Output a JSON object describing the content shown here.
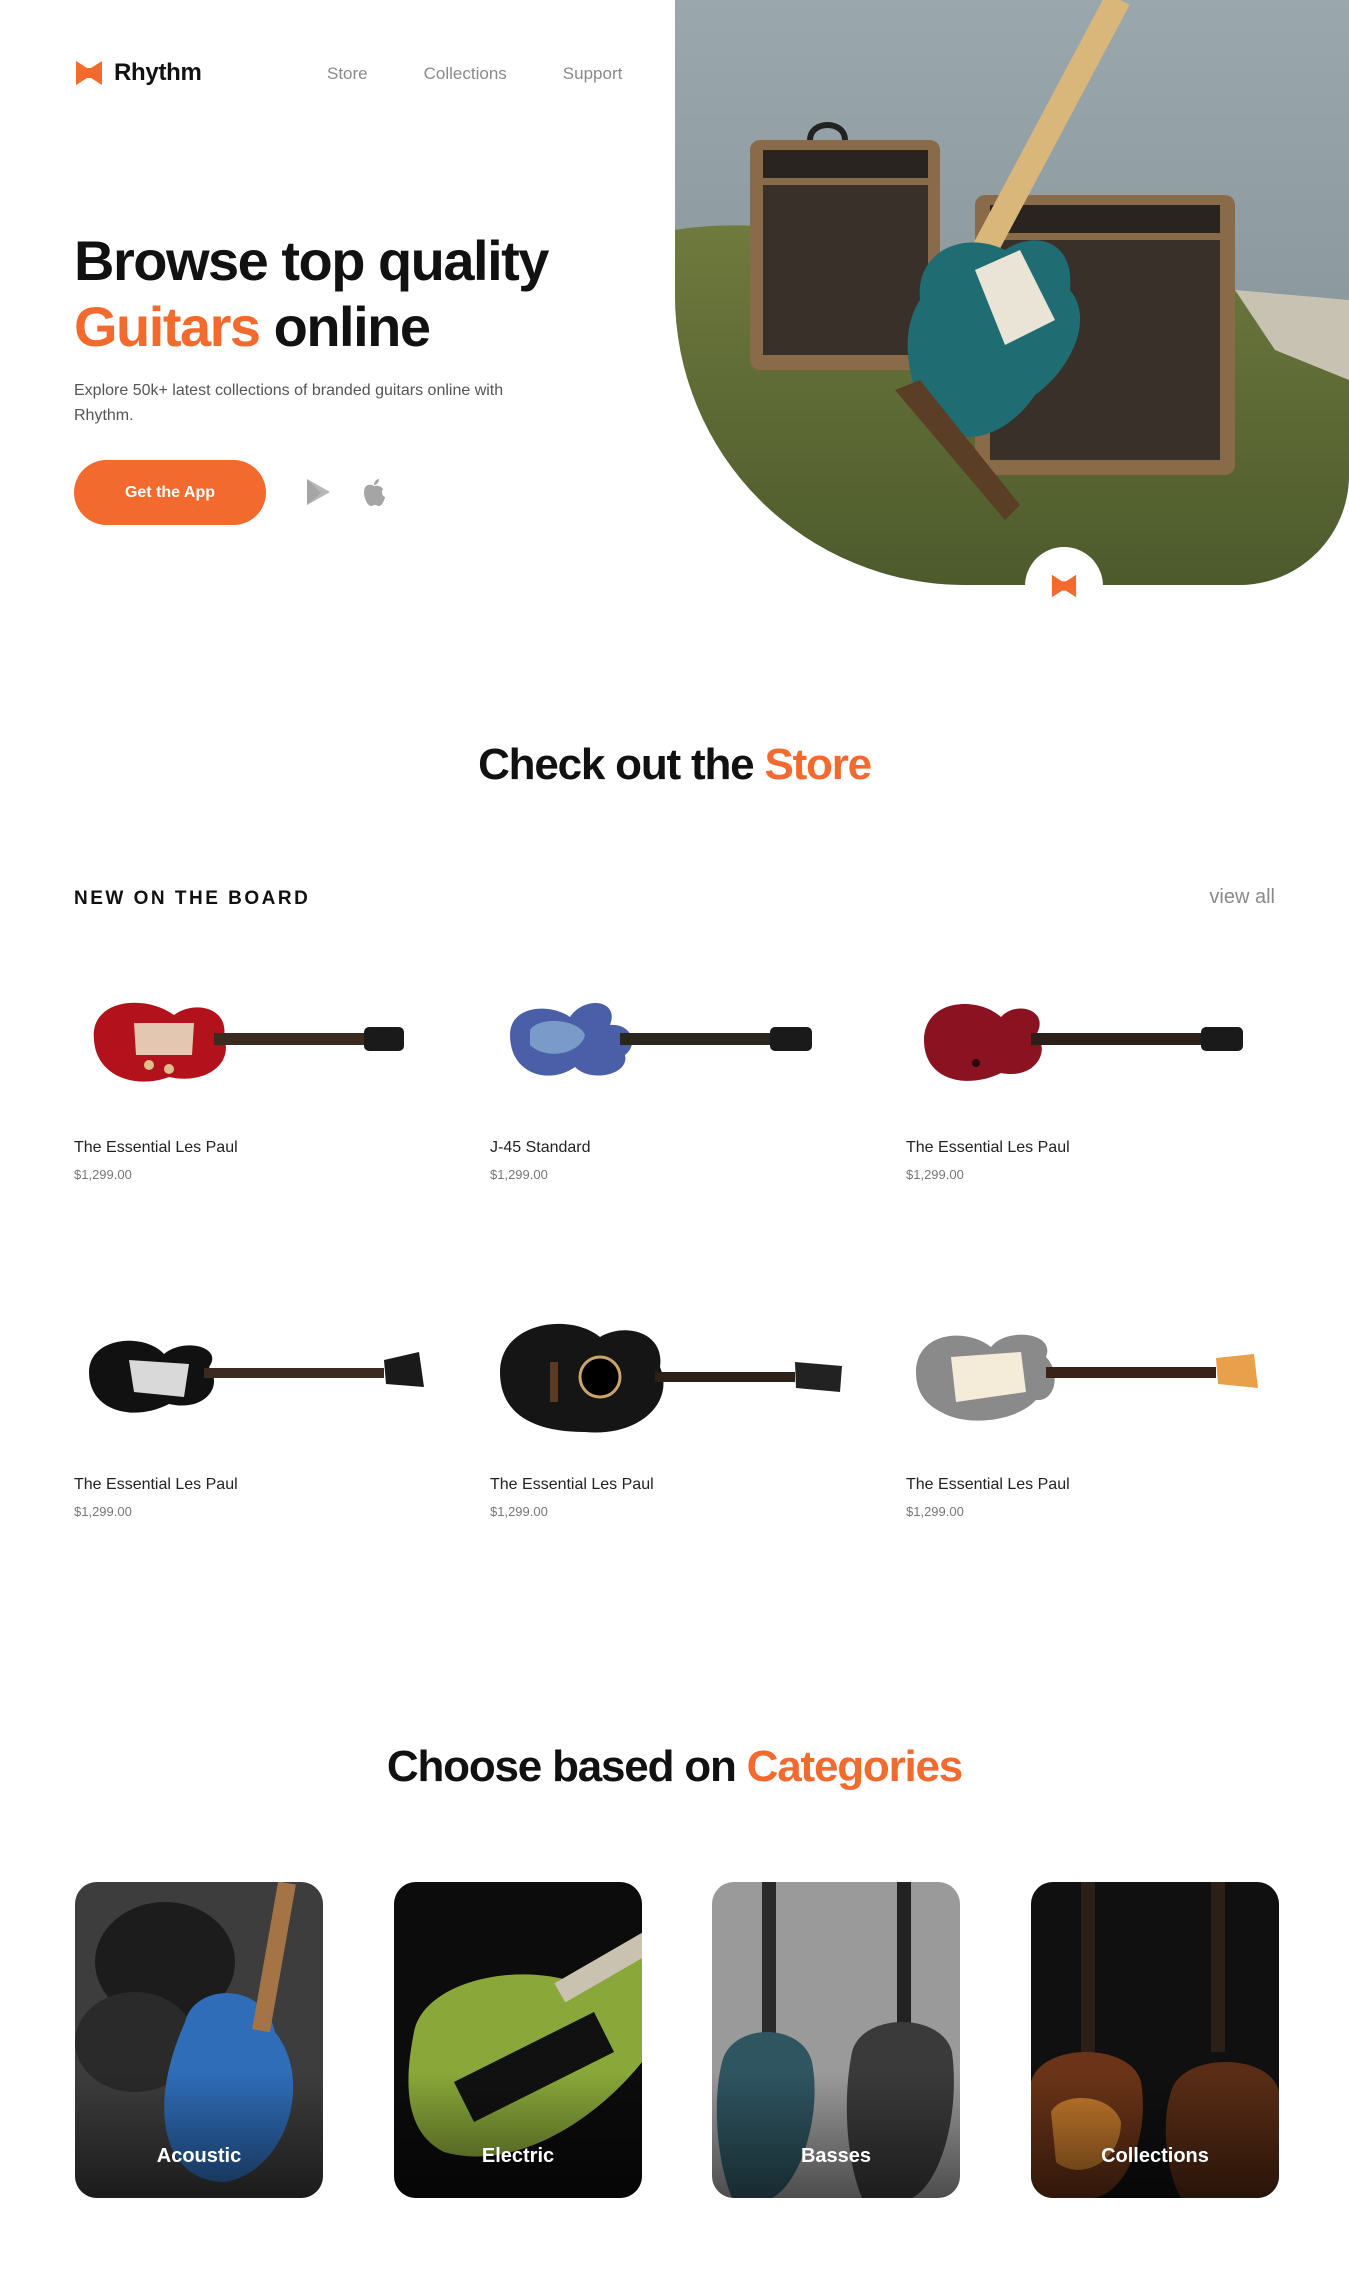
{
  "brand": {
    "name": "Rhythm",
    "accent_color": "#f26a2e",
    "logo_icon": "bowtie-logo-icon"
  },
  "nav": {
    "items": [
      "Store",
      "Collections",
      "Support"
    ]
  },
  "hero": {
    "title_line1": "Browse top quality",
    "title_accent": "Guitars",
    "title_rest": " online",
    "subtitle": "Explore 50k+ latest collections of branded guitars online with Rhythm.",
    "cta_label": "Get the App",
    "store_icons": [
      "google-play-icon",
      "apple-icon"
    ]
  },
  "store_section": {
    "title_prefix": "Check out the ",
    "title_accent": "Store",
    "board_label": "NEW ON THE BOARD",
    "view_all": "view all"
  },
  "products": [
    {
      "name": "The Essential Les Paul",
      "price": "$1,299.00",
      "icon": "red-les-paul-guitar"
    },
    {
      "name": "J-45 Standard",
      "price": "$1,299.00",
      "icon": "blue-sg-guitar"
    },
    {
      "name": "The Essential Les Paul",
      "price": "$1,299.00",
      "icon": "cherry-double-cut-guitar"
    },
    {
      "name": "The Essential Les Paul",
      "price": "$1,299.00",
      "icon": "black-bass-guitar"
    },
    {
      "name": "The Essential Les Paul",
      "price": "$1,299.00",
      "icon": "black-acoustic-guitar"
    },
    {
      "name": "The Essential Les Paul",
      "price": "$1,299.00",
      "icon": "silver-stratocaster-guitar"
    }
  ],
  "categories_section": {
    "title_prefix": "Choose based on ",
    "title_accent": "Categories",
    "items": [
      "Acoustic",
      "Electric",
      "Basses",
      "Collections"
    ]
  }
}
